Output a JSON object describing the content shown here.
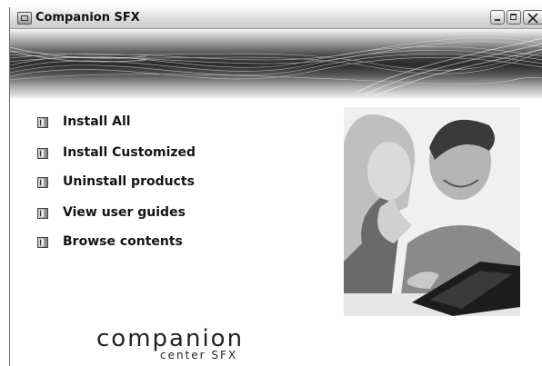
{
  "window": {
    "title": "Companion SFX",
    "icon": "app-window-icon",
    "controls": [
      "minimize-icon",
      "maximize-icon",
      "close-icon"
    ]
  },
  "banner": {
    "style": "grayscale wave lines"
  },
  "menu": {
    "bullet_icon": "book-icon",
    "items": [
      {
        "label": "Install All"
      },
      {
        "label": "Install Customized"
      },
      {
        "label": "Uninstall products"
      },
      {
        "label": "View user guides"
      },
      {
        "label": "Browse contents"
      }
    ]
  },
  "photo": {
    "subject": "couple looking at a laptop"
  },
  "logo": {
    "main": "companion",
    "sub": "center SFX"
  },
  "colors": {
    "text": "#141414",
    "titlebar": "#dcdcdc",
    "banner_dark": "#2b2b2b"
  }
}
